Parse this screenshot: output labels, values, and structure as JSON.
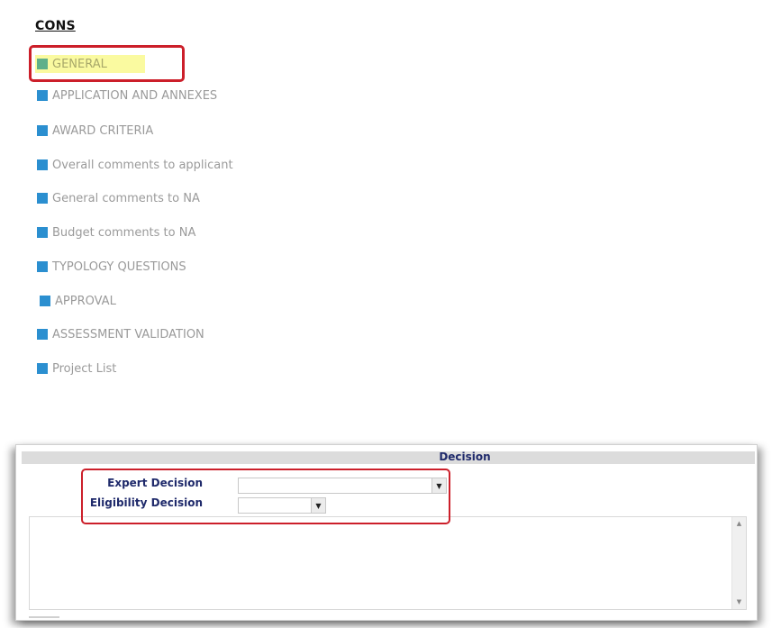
{
  "title": "CONS",
  "nav": {
    "items": [
      {
        "label": "GENERAL",
        "active": true
      },
      {
        "label": "APPLICATION AND ANNEXES"
      },
      {
        "label": "AWARD CRITERIA"
      },
      {
        "label": "Overall comments to applicant"
      },
      {
        "label": "General comments to NA"
      },
      {
        "label": "Budget comments to NA"
      },
      {
        "label": "TYPOLOGY QUESTIONS"
      },
      {
        "label": "APPROVAL"
      },
      {
        "label": "ASSESSMENT VALIDATION"
      },
      {
        "label": "Project List"
      }
    ]
  },
  "decision": {
    "header": "Decision",
    "expert_decision_label": "Expert Decision",
    "expert_decision_value": "",
    "eligibility_decision_label": "Eligibility Decision",
    "eligibility_decision_value": "",
    "comment_text": ""
  },
  "colors": {
    "nav_square": "#2b8fd0",
    "active_square": "#5fb08a",
    "active_highlight": "#fafaa0",
    "annotation_box": "#cc1f2a",
    "label_text": "#1f2a6b"
  }
}
